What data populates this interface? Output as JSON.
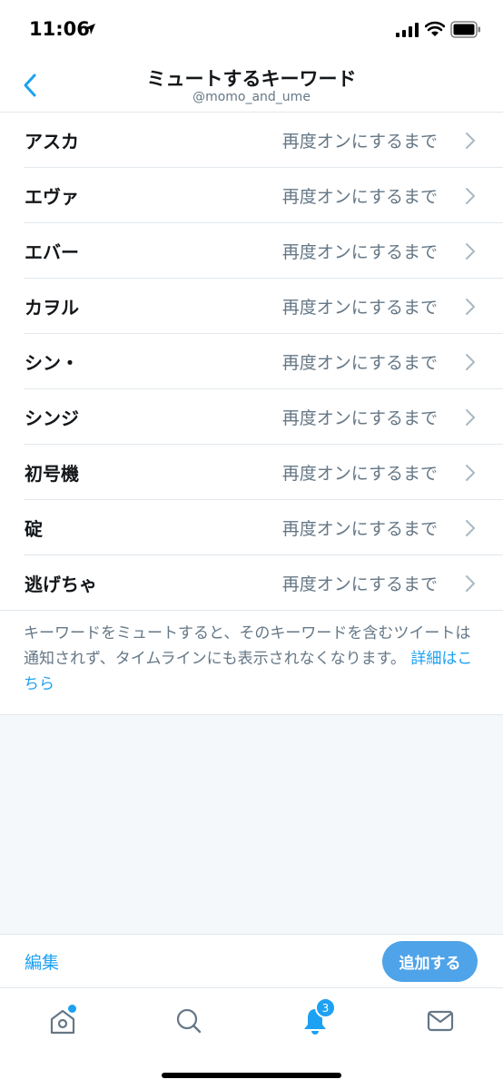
{
  "status_bar": {
    "time": "11:06"
  },
  "header": {
    "title": "ミュートするキーワード",
    "subtitle": "@momo_and_ume"
  },
  "keywords": [
    {
      "label": "アスカ",
      "duration": "再度オンにするまで"
    },
    {
      "label": "エヴァ",
      "duration": "再度オンにするまで"
    },
    {
      "label": "エバー",
      "duration": "再度オンにするまで"
    },
    {
      "label": "カヲル",
      "duration": "再度オンにするまで"
    },
    {
      "label": "シン・",
      "duration": "再度オンにするまで"
    },
    {
      "label": "シンジ",
      "duration": "再度オンにするまで"
    },
    {
      "label": "初号機",
      "duration": "再度オンにするまで"
    },
    {
      "label": "碇",
      "duration": "再度オンにするまで"
    },
    {
      "label": "逃げちゃ",
      "duration": "再度オンにするまで"
    }
  ],
  "description": {
    "text": "キーワードをミュートすると、そのキーワードを含むツイートは通知されず、タイムラインにも表示されなくなります。",
    "link": "詳細はこちら"
  },
  "actions": {
    "edit_label": "編集",
    "add_label": "追加する"
  },
  "tab_bar": {
    "notification_count": "3",
    "tabs": [
      "home-icon",
      "search-icon",
      "bell-icon",
      "mail-icon"
    ]
  },
  "colors": {
    "accent": "#1da1f2",
    "add_button": "#4fa3e8",
    "secondary_text": "#657786",
    "divider": "#e1e8ed",
    "background_gray": "#f5f8fa"
  }
}
